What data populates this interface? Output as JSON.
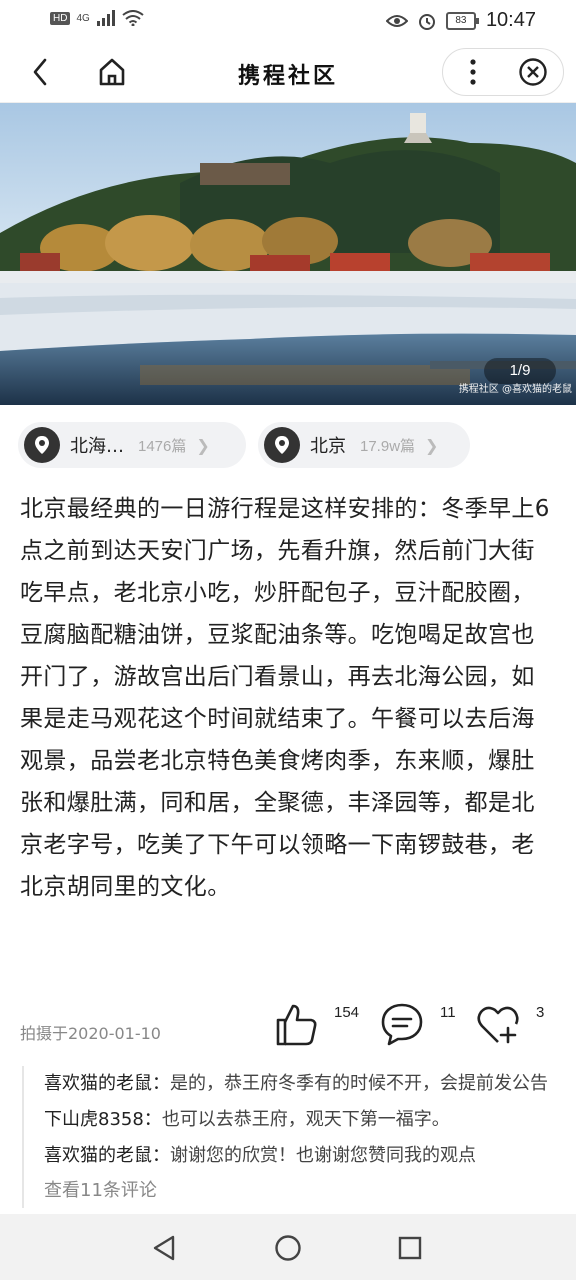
{
  "status_bar": {
    "hd": "HD",
    "network": "4G",
    "battery": "83",
    "time": "10:47"
  },
  "header": {
    "title": "携程社区"
  },
  "hero": {
    "pager": "1/9",
    "watermark": "携程社区 @喜欢猫的老鼠"
  },
  "tags": [
    {
      "name": "北海…",
      "count": "1476篇"
    },
    {
      "name": "北京",
      "count": "17.9w篇"
    }
  ],
  "article": {
    "text": "北京最经典的一日游行程是这样安排的：冬季早上6点之前到达天安门广场，先看升旗，然后前门大街吃早点，老北京小吃，炒肝配包子，豆汁配胶圈，豆腐脑配糖油饼，豆浆配油条等。吃饱喝足故宫也开门了，游故宫出后门看景山，再去北海公园，如果是走马观花这个时间就结束了。午餐可以去后海观景，品尝老北京特色美食烤肉季，东来顺，爆肚张和爆肚满，同和居，全聚德，丰泽园等，都是北京老字号，吃美了下午可以领略一下南锣鼓巷，老北京胡同里的文化。"
  },
  "meta": {
    "shot_date": "拍摄于2020-01-10",
    "likes": "154",
    "comments": "11",
    "favorites": "3"
  },
  "comments": [
    {
      "user": "喜欢猫的老鼠：",
      "text": "是的，恭王府冬季有的时候不开，会提前发公告"
    },
    {
      "user": "下山虎8358：",
      "text": "也可以去恭王府，观天下第一福字。"
    },
    {
      "user": "喜欢猫的老鼠：",
      "text": "谢谢您的欣赏！也谢谢您赞同我的观点"
    }
  ],
  "view_all": "查看11条评论"
}
